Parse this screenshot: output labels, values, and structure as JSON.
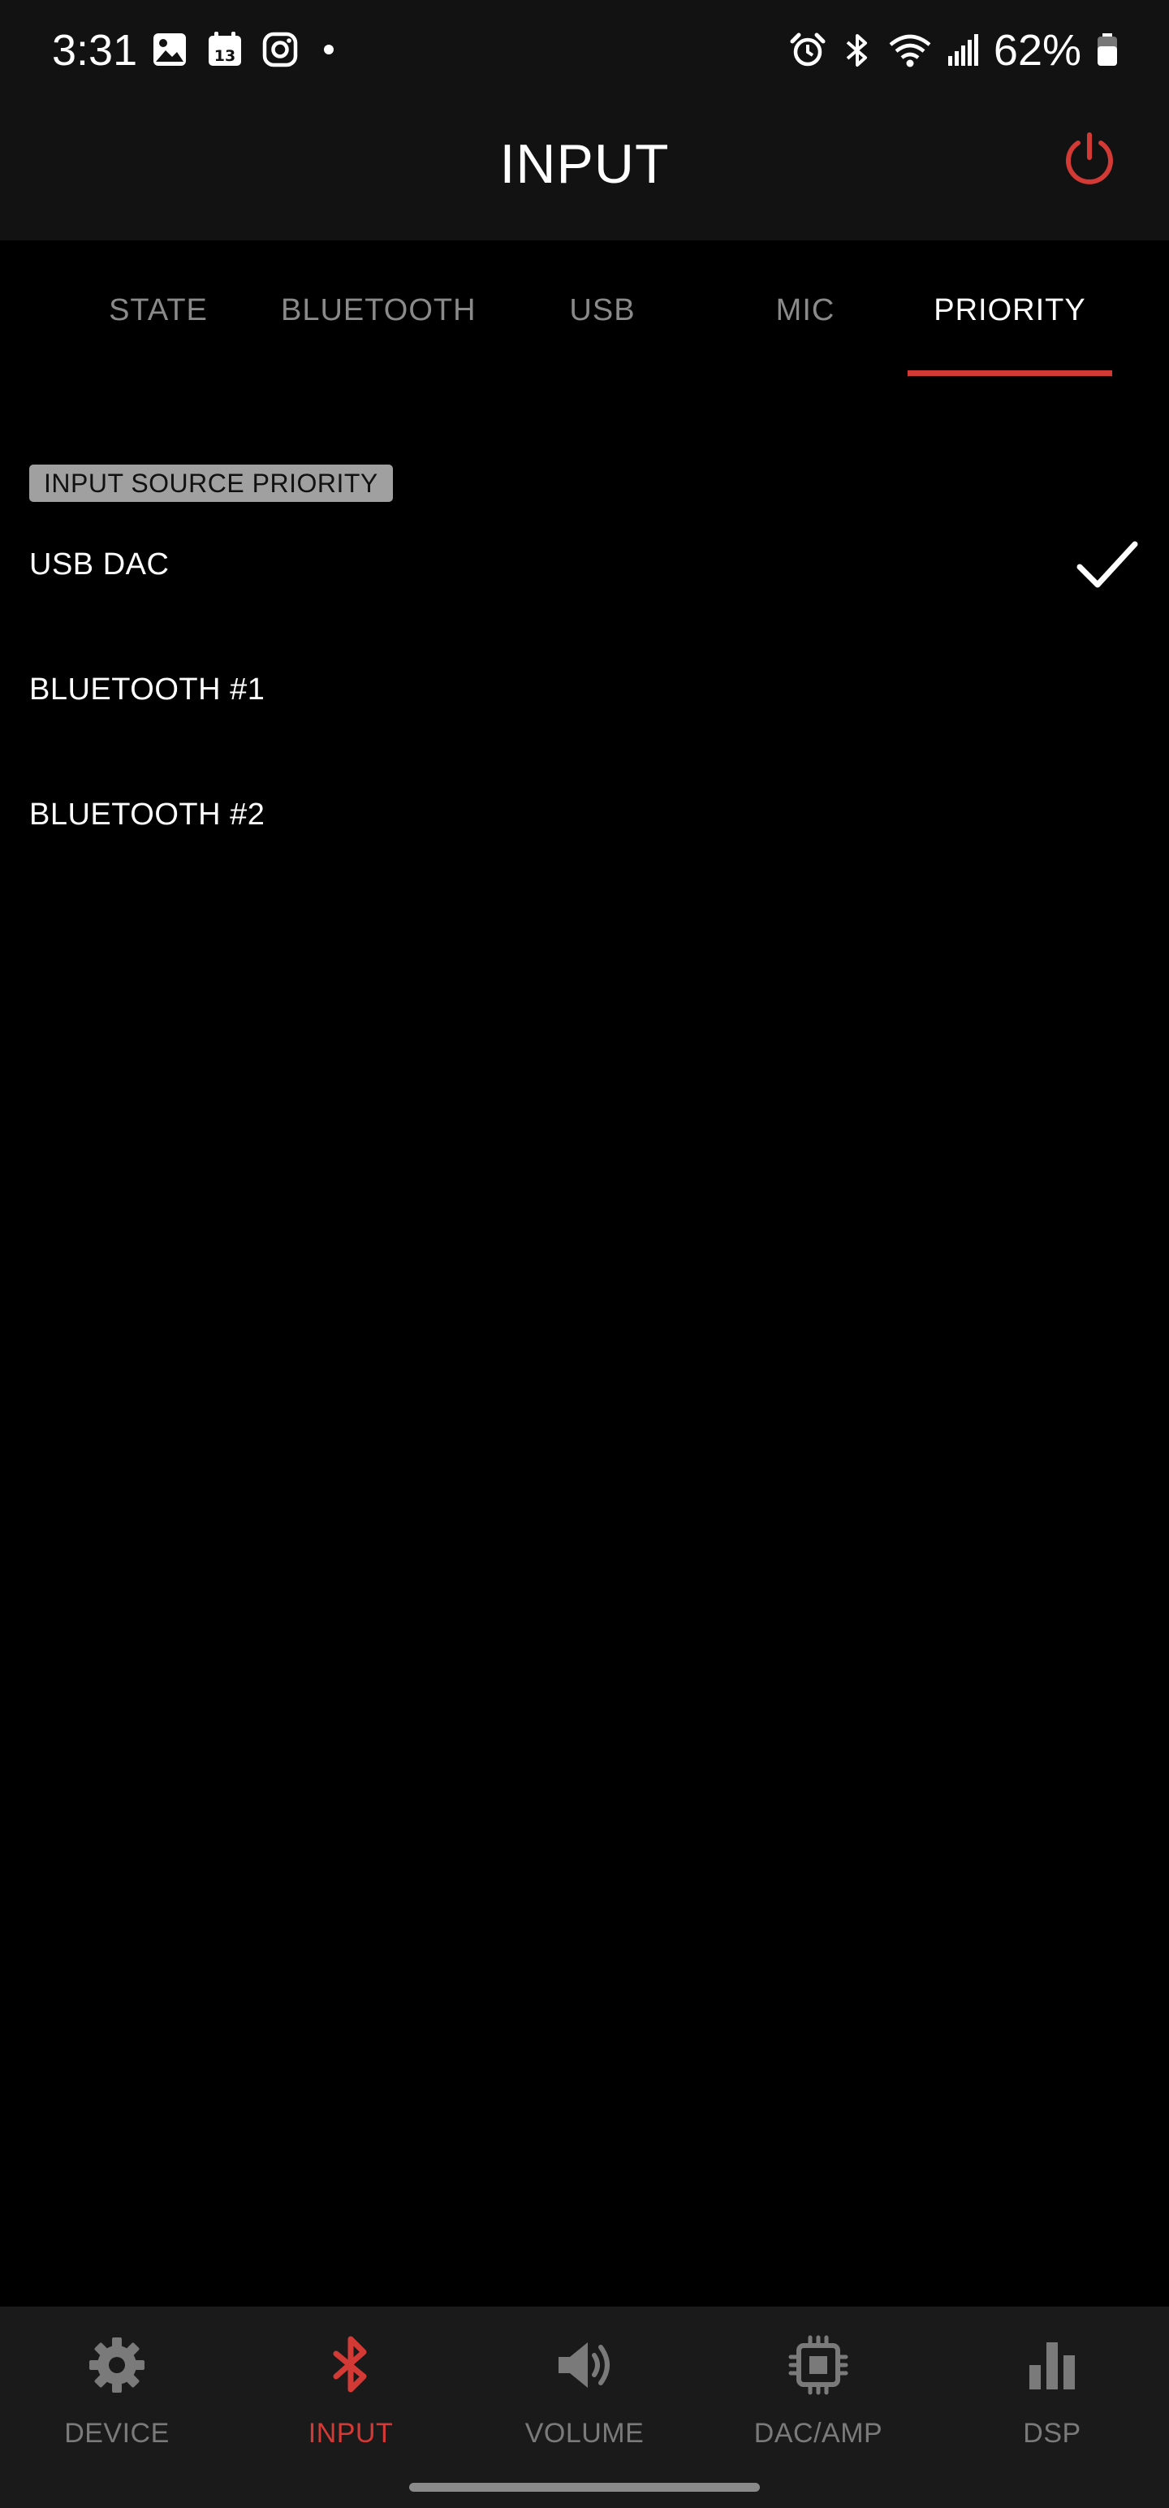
{
  "status_bar": {
    "time": "3:31",
    "battery_percent": "62%",
    "left_icons": [
      "gallery-icon",
      "calendar-icon",
      "instagram-icon",
      "dot-icon"
    ],
    "calendar_day": "13",
    "right_icons": [
      "alarm-icon",
      "bluetooth-icon",
      "wifi-icon",
      "signal-icon",
      "battery-icon"
    ]
  },
  "header": {
    "title": "INPUT",
    "power_icon": "power-icon",
    "power_color": "#d33a36"
  },
  "tabs": [
    {
      "label": "STATE",
      "active": false
    },
    {
      "label": "BLUETOOTH",
      "active": false
    },
    {
      "label": "USB",
      "active": false
    },
    {
      "label": "MIC",
      "active": false
    },
    {
      "label": "PRIORITY",
      "active": true
    }
  ],
  "priority": {
    "section_label": "INPUT SOURCE PRIORITY",
    "items": [
      {
        "label": "USB DAC",
        "selected": true
      },
      {
        "label": "BLUETOOTH #1",
        "selected": false
      },
      {
        "label": "BLUETOOTH #2",
        "selected": false
      }
    ]
  },
  "bottom_nav": {
    "items": [
      {
        "label": "DEVICE",
        "icon": "gear-icon",
        "active": false
      },
      {
        "label": "INPUT",
        "icon": "bluetooth-icon",
        "active": true
      },
      {
        "label": "VOLUME",
        "icon": "speaker-icon",
        "active": false
      },
      {
        "label": "DAC/AMP",
        "icon": "chip-icon",
        "active": false
      },
      {
        "label": "DSP",
        "icon": "bar-chart-icon",
        "active": false
      }
    ]
  },
  "colors": {
    "accent": "#d33a36",
    "background": "#000000",
    "bar_background": "#121212",
    "inactive_text": "#8a8a8a"
  }
}
